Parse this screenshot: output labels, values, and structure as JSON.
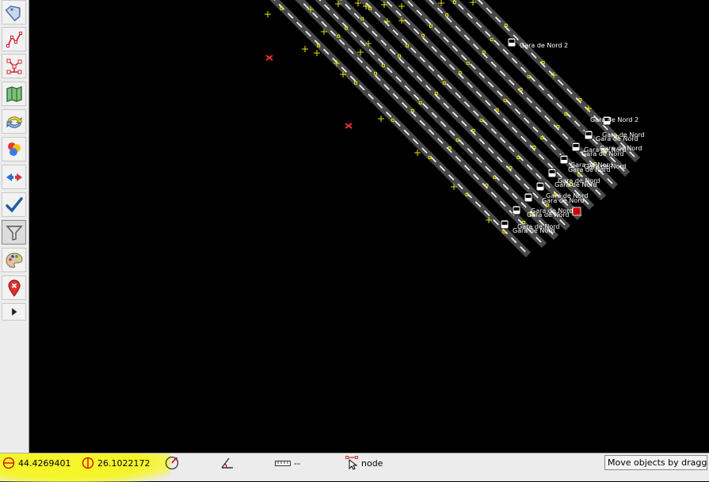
{
  "toolbar": {
    "buttons": [
      {
        "icon": "tag-icon"
      },
      {
        "icon": "draw-way-icon"
      },
      {
        "icon": "relation-icon"
      },
      {
        "icon": "map-icon"
      },
      {
        "icon": "refresh-icon"
      },
      {
        "icon": "layers-icon"
      },
      {
        "icon": "merge-icon"
      },
      {
        "icon": "validate-check-icon"
      },
      {
        "icon": "filter-icon"
      },
      {
        "icon": "paint-palette-icon"
      },
      {
        "icon": "remove-marker-icon"
      },
      {
        "icon": "expand-arrow-icon"
      }
    ],
    "active_index": 8
  },
  "map": {
    "labels": [
      "Gara de Nord 2",
      "Gara de Nord 2",
      "Gara de Nord",
      "Gara de Nord",
      "Gara de Nord",
      "Gara de Nord",
      "Gara de Nord",
      "Gara de Nord",
      "Gara de Nord",
      "Gara de Nord",
      "Gara de Nord",
      "Gara de Nord",
      "Gara de Nord",
      "Gara de Nord",
      "Gara de Nord",
      "Gara de Nord",
      "Gara de Nord",
      "Gara de Nord"
    ]
  },
  "statusbar": {
    "latitude": "44.4269401",
    "longitude": "26.1022172",
    "heading": "",
    "angle": "",
    "distance": "--",
    "mode": "node",
    "help": "Move objects by dragging;"
  },
  "colors": {
    "highlight": "#f5f52a",
    "track": "#4a4a4a",
    "dash": "#ffffff",
    "node": "#e8e000",
    "marker": "#cc0000"
  }
}
